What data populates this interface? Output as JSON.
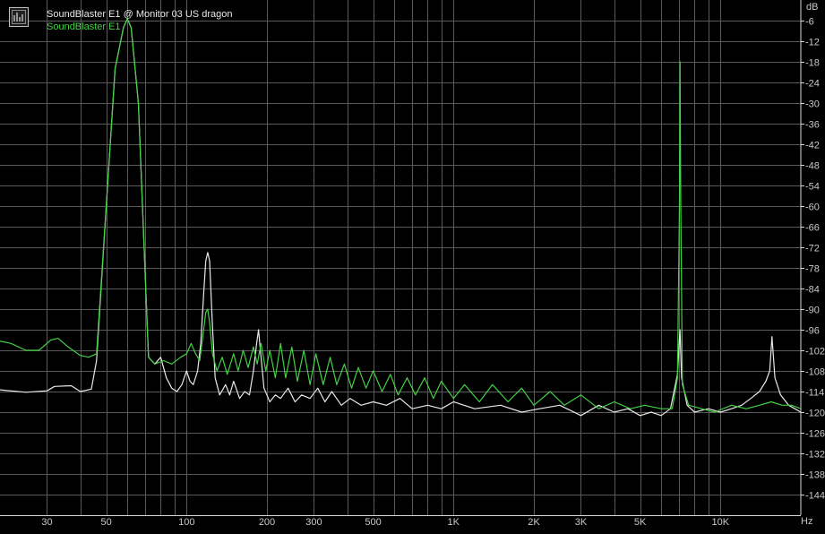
{
  "chart_data": {
    "type": "line",
    "xscale": "log",
    "xlim": [
      20,
      20000
    ],
    "ylim": [
      -150,
      0
    ],
    "x_unit_label": "Hz",
    "y_unit_label": "dB",
    "grid": true,
    "legend_position": "top-left",
    "x_ticks": [
      {
        "value": 30,
        "label": "30"
      },
      {
        "value": 50,
        "label": "50"
      },
      {
        "value": 100,
        "label": "100"
      },
      {
        "value": 200,
        "label": "200"
      },
      {
        "value": 300,
        "label": "300"
      },
      {
        "value": 500,
        "label": "500"
      },
      {
        "value": 1000,
        "label": "1K"
      },
      {
        "value": 2000,
        "label": "2K"
      },
      {
        "value": 3000,
        "label": "3K"
      },
      {
        "value": 5000,
        "label": "5K"
      },
      {
        "value": 10000,
        "label": "10K"
      }
    ],
    "y_ticks": [
      -6,
      -12,
      -18,
      -24,
      -30,
      -36,
      -42,
      -48,
      -54,
      -60,
      -66,
      -72,
      -78,
      -84,
      -90,
      -96,
      -102,
      -108,
      -114,
      -120,
      -126,
      -132,
      -138,
      -144
    ],
    "series": [
      {
        "name": "SoundBlaster E1 @ Monitor 03 US dragon",
        "color": "#e8e8e8",
        "points": [
          [
            20,
            -113.5
          ],
          [
            25,
            -114.2
          ],
          [
            30,
            -113.8
          ],
          [
            32,
            -112.5
          ],
          [
            37,
            -112.3
          ],
          [
            40,
            -114.0
          ],
          [
            44,
            -113.3
          ],
          [
            46,
            -105
          ],
          [
            50,
            -60
          ],
          [
            54,
            -20
          ],
          [
            58,
            -8
          ],
          [
            60,
            -5.5
          ],
          [
            62,
            -8
          ],
          [
            66,
            -30
          ],
          [
            70,
            -80
          ],
          [
            72,
            -104
          ],
          [
            76,
            -106
          ],
          [
            80,
            -104
          ],
          [
            84,
            -110
          ],
          [
            88,
            -113
          ],
          [
            92,
            -114
          ],
          [
            96,
            -112
          ],
          [
            100,
            -108
          ],
          [
            103,
            -111
          ],
          [
            106,
            -112
          ],
          [
            110,
            -108
          ],
          [
            113,
            -100
          ],
          [
            116,
            -85
          ],
          [
            118,
            -76
          ],
          [
            120,
            -73.5
          ],
          [
            122,
            -76
          ],
          [
            125,
            -95
          ],
          [
            128,
            -110
          ],
          [
            133,
            -115
          ],
          [
            140,
            -112
          ],
          [
            145,
            -115
          ],
          [
            150,
            -111
          ],
          [
            158,
            -116
          ],
          [
            165,
            -114
          ],
          [
            172,
            -115
          ],
          [
            178,
            -108
          ],
          [
            183,
            -100
          ],
          [
            186,
            -96
          ],
          [
            189,
            -102
          ],
          [
            195,
            -113
          ],
          [
            205,
            -117
          ],
          [
            215,
            -115
          ],
          [
            225,
            -116
          ],
          [
            240,
            -113
          ],
          [
            255,
            -117
          ],
          [
            270,
            -115
          ],
          [
            290,
            -116
          ],
          [
            310,
            -113
          ],
          [
            330,
            -117
          ],
          [
            350,
            -114
          ],
          [
            380,
            -118
          ],
          [
            410,
            -116
          ],
          [
            450,
            -118
          ],
          [
            500,
            -117
          ],
          [
            560,
            -118
          ],
          [
            630,
            -116
          ],
          [
            700,
            -119
          ],
          [
            800,
            -118
          ],
          [
            900,
            -119
          ],
          [
            1000,
            -117
          ],
          [
            1200,
            -119
          ],
          [
            1500,
            -118
          ],
          [
            1800,
            -120
          ],
          [
            2100,
            -119
          ],
          [
            2500,
            -118
          ],
          [
            3000,
            -121
          ],
          [
            3500,
            -118
          ],
          [
            4000,
            -120
          ],
          [
            4500,
            -119
          ],
          [
            5000,
            -121
          ],
          [
            5500,
            -120
          ],
          [
            6000,
            -121
          ],
          [
            6500,
            -119
          ],
          [
            6900,
            -109
          ],
          [
            7050,
            -96
          ],
          [
            7150,
            -110
          ],
          [
            7500,
            -118
          ],
          [
            8000,
            -120
          ],
          [
            9000,
            -119
          ],
          [
            10000,
            -120
          ],
          [
            11000,
            -119
          ],
          [
            12000,
            -118
          ],
          [
            13000,
            -116
          ],
          [
            14000,
            -114
          ],
          [
            14800,
            -111
          ],
          [
            15300,
            -108
          ],
          [
            15600,
            -98
          ],
          [
            16000,
            -110
          ],
          [
            16800,
            -115
          ],
          [
            18000,
            -118
          ],
          [
            19000,
            -119
          ],
          [
            20000,
            -120
          ]
        ]
      },
      {
        "name": "SoundBlaster E1",
        "color": "#44d044",
        "points": [
          [
            20,
            -99.3
          ],
          [
            22,
            -100
          ],
          [
            25,
            -102
          ],
          [
            28,
            -102
          ],
          [
            31,
            -99
          ],
          [
            33,
            -98.5
          ],
          [
            36,
            -101
          ],
          [
            40,
            -103.5
          ],
          [
            43,
            -104
          ],
          [
            46,
            -103
          ],
          [
            50,
            -60
          ],
          [
            54,
            -20
          ],
          [
            58,
            -8
          ],
          [
            60,
            -5.5
          ],
          [
            62,
            -8
          ],
          [
            66,
            -30
          ],
          [
            70,
            -80
          ],
          [
            72,
            -104
          ],
          [
            76,
            -106
          ],
          [
            82,
            -105
          ],
          [
            88,
            -106
          ],
          [
            95,
            -104
          ],
          [
            100,
            -103
          ],
          [
            104,
            -100
          ],
          [
            108,
            -103
          ],
          [
            112,
            -105
          ],
          [
            115,
            -98
          ],
          [
            118,
            -91
          ],
          [
            120,
            -90
          ],
          [
            122,
            -94
          ],
          [
            125,
            -103
          ],
          [
            130,
            -108
          ],
          [
            136,
            -104
          ],
          [
            142,
            -109
          ],
          [
            150,
            -103
          ],
          [
            156,
            -108
          ],
          [
            163,
            -102
          ],
          [
            170,
            -107
          ],
          [
            178,
            -101
          ],
          [
            184,
            -106
          ],
          [
            190,
            -100
          ],
          [
            198,
            -108
          ],
          [
            205,
            -102
          ],
          [
            215,
            -110
          ],
          [
            225,
            -100
          ],
          [
            235,
            -110
          ],
          [
            248,
            -101
          ],
          [
            260,
            -111
          ],
          [
            275,
            -102
          ],
          [
            290,
            -112
          ],
          [
            305,
            -103
          ],
          [
            325,
            -112
          ],
          [
            345,
            -104
          ],
          [
            365,
            -112
          ],
          [
            390,
            -106
          ],
          [
            415,
            -113
          ],
          [
            440,
            -107
          ],
          [
            470,
            -113
          ],
          [
            500,
            -108
          ],
          [
            540,
            -114
          ],
          [
            580,
            -109
          ],
          [
            620,
            -115
          ],
          [
            670,
            -110
          ],
          [
            720,
            -115
          ],
          [
            780,
            -110
          ],
          [
            840,
            -116
          ],
          [
            900,
            -111
          ],
          [
            1000,
            -116
          ],
          [
            1100,
            -112
          ],
          [
            1250,
            -117
          ],
          [
            1400,
            -112
          ],
          [
            1600,
            -117
          ],
          [
            1800,
            -113
          ],
          [
            2000,
            -118
          ],
          [
            2300,
            -114
          ],
          [
            2600,
            -118
          ],
          [
            3000,
            -115
          ],
          [
            3500,
            -119
          ],
          [
            4000,
            -117
          ],
          [
            4600,
            -119
          ],
          [
            5200,
            -118
          ],
          [
            6000,
            -119
          ],
          [
            6600,
            -119
          ],
          [
            6900,
            -110
          ],
          [
            7020,
            -60
          ],
          [
            7060,
            -18
          ],
          [
            7100,
            -60
          ],
          [
            7200,
            -112
          ],
          [
            7600,
            -118
          ],
          [
            8500,
            -119
          ],
          [
            9500,
            -120
          ],
          [
            11000,
            -118
          ],
          [
            12500,
            -119
          ],
          [
            14000,
            -118
          ],
          [
            15500,
            -117
          ],
          [
            17000,
            -118
          ],
          [
            18500,
            -118
          ],
          [
            20000,
            -119
          ]
        ]
      }
    ]
  }
}
